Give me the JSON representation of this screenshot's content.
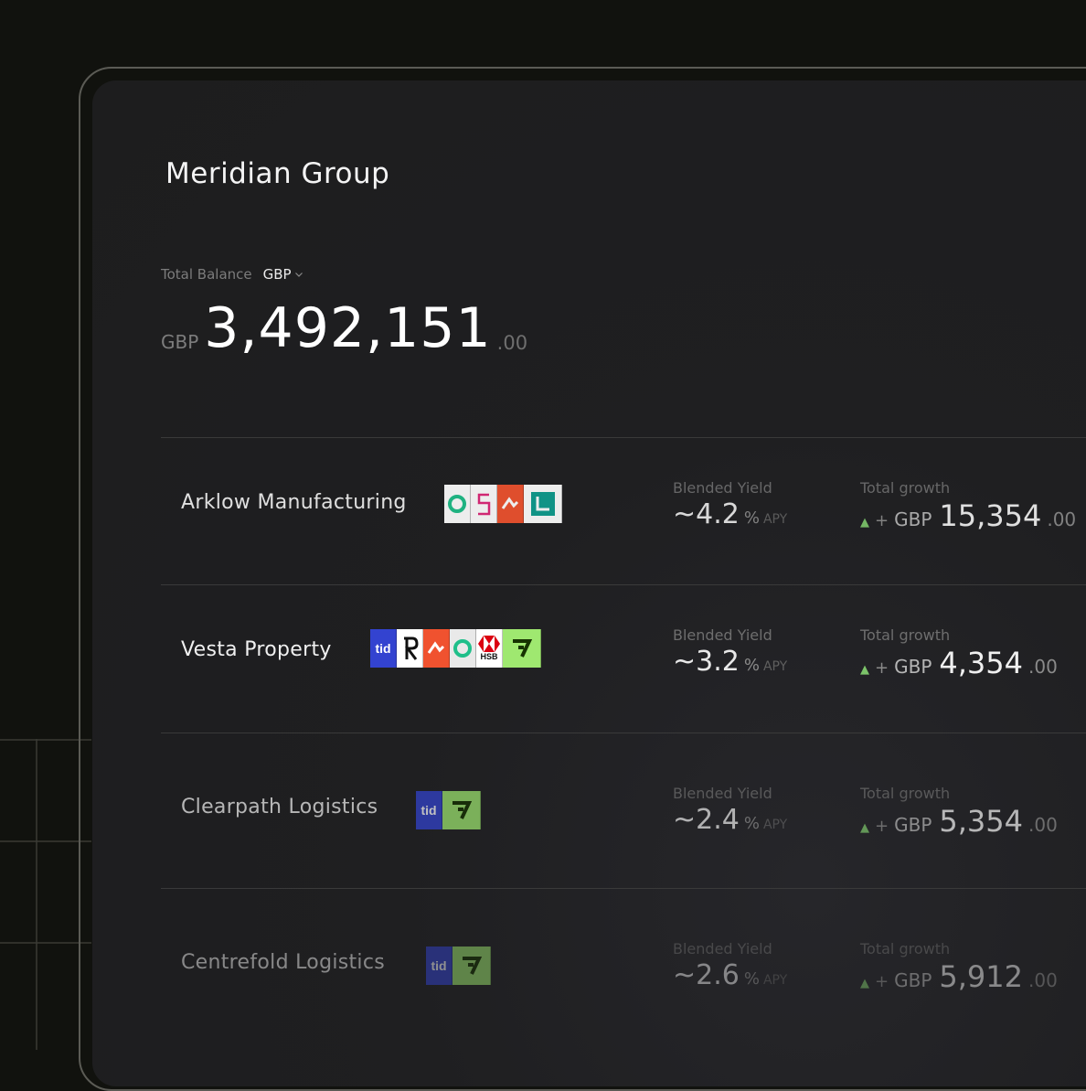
{
  "company": {
    "name": "Meridian Group"
  },
  "balance": {
    "label": "Total Balance",
    "currency_selected": "GBP",
    "prefix": "GBP",
    "integer": "3,492,151",
    "decimal": ".00"
  },
  "accounts": [
    {
      "name": "Arklow Manufacturing",
      "logos": [
        "ring-logo",
        "pink-s-logo",
        "orange-arrow-logo",
        "teal-l-logo"
      ],
      "yield_label": "Blended Yield",
      "yield_value": "~4.2",
      "yield_unit": "%",
      "yield_suffix": "APY",
      "growth_label": "Total growth",
      "growth_sign": "+",
      "growth_currency": "GBP",
      "growth_integer": "15,354",
      "growth_decimal": ".00"
    },
    {
      "name": "Vesta Property",
      "logos": [
        "tide-logo",
        "revolut-logo",
        "orange-arrow-logo",
        "ring-logo",
        "hsbc-logo",
        "wise-logo"
      ],
      "yield_label": "Blended Yield",
      "yield_value": "~3.2",
      "yield_unit": "%",
      "yield_suffix": "APY",
      "growth_label": "Total growth",
      "growth_sign": "+",
      "growth_currency": "GBP",
      "growth_integer": "4,354",
      "growth_decimal": ".00"
    },
    {
      "name": "Clearpath Logistics",
      "logos": [
        "tide-logo",
        "wise-logo"
      ],
      "yield_label": "Blended Yield",
      "yield_value": "~2.4",
      "yield_unit": "%",
      "yield_suffix": "APY",
      "growth_label": "Total growth",
      "growth_sign": "+",
      "growth_currency": "GBP",
      "growth_integer": "5,354",
      "growth_decimal": ".00"
    },
    {
      "name": "Centrefold Logistics",
      "logos": [
        "tide-logo",
        "wise-logo"
      ],
      "yield_label": "Blended Yield",
      "yield_value": "~2.6",
      "yield_unit": "%",
      "yield_suffix": "APY",
      "growth_label": "Total growth",
      "growth_sign": "+",
      "growth_currency": "GBP",
      "growth_integer": "5,912",
      "growth_decimal": ".00"
    }
  ],
  "logo_text": {
    "tide": "tid",
    "hsbc": "HSB"
  },
  "colors": {
    "background": "#11120e",
    "panel": "#1f1f21",
    "growth_up": "#7cc46a",
    "tide_blue": "#3343d0",
    "wise_green": "#9fe870",
    "accent_orange": "#f0522f",
    "teal": "#0f9d8f"
  }
}
